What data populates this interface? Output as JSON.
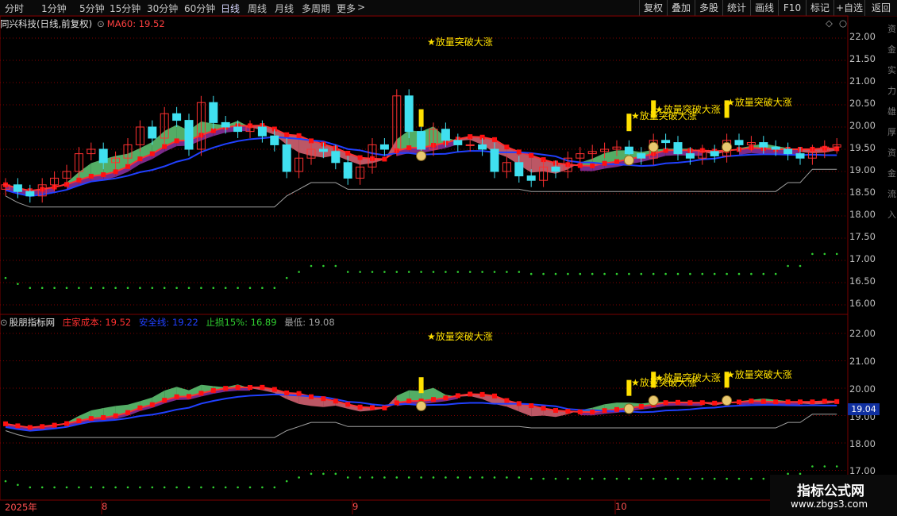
{
  "toolbar": {
    "periods": [
      "分时",
      "1分钟",
      "5分钟",
      "15分钟",
      "30分钟",
      "60分钟",
      "日线",
      "周线",
      "月线",
      "多周期",
      "更多"
    ],
    "active_period": "日线",
    "more_arrow": ">",
    "right_buttons": [
      "复权",
      "叠加",
      "多股",
      "统计",
      "画线",
      "F10",
      "标记",
      "+自选",
      "返回"
    ]
  },
  "main_panel": {
    "title": "同兴科技(日线,前复权)",
    "ma_label": "MA60: 19.52",
    "y_ticks": [
      "22.00",
      "21.50",
      "21.00",
      "20.50",
      "20.00",
      "19.50",
      "19.00",
      "18.50",
      "18.00",
      "17.50",
      "17.00",
      "16.50",
      "16.00"
    ],
    "signal_label": "★放量突破大涨"
  },
  "indicator_panel": {
    "title": "股朋指标网",
    "fields": [
      {
        "label": "庄家成本:",
        "value": "19.52",
        "color": "#ff3030"
      },
      {
        "label": "安全线:",
        "value": "19.22",
        "color": "#2040ff"
      },
      {
        "label": "止损15%:",
        "value": "16.89",
        "color": "#30d030"
      },
      {
        "label": "最低:",
        "value": "19.08",
        "color": "#a0a0a0"
      }
    ],
    "y_ticks": [
      "22.00",
      "21.00",
      "20.00",
      "19.00",
      "18.00",
      "17.00"
    ],
    "price_badge": "19.04",
    "signal_label": "★放量突破大涨"
  },
  "x_axis": {
    "labels": [
      "2025年",
      "8",
      "9",
      "10"
    ]
  },
  "side_text": "资金实力雄厚资金流入",
  "watermark": {
    "line1": "指标公式网",
    "line2": "www.zbgs3.com"
  },
  "colors": {
    "up": "#ff3030",
    "down": "#40e0f0",
    "ma_blue": "#2040ff",
    "green_band": "#5cc070",
    "purple_band": "#7a2a8a",
    "pink_band": "#d06070",
    "signal": "#ffe000",
    "grid": "#800000"
  },
  "chart_data": [
    {
      "type": "candlestick",
      "title": "同兴科技(日线,前复权)",
      "ylim": [
        16.0,
        22.0
      ],
      "x_labels": [
        "2025年",
        "8",
        "9",
        "10"
      ],
      "series": [
        {
          "name": "MA60",
          "last": 19.52
        },
        {
          "name": "close",
          "values": [
            18.7,
            18.55,
            18.45,
            18.7,
            18.85,
            19.0,
            19.4,
            19.5,
            19.2,
            19.3,
            19.6,
            20.0,
            19.75,
            20.3,
            20.15,
            19.5,
            20.55,
            20.1,
            20.0,
            19.9,
            20.0,
            19.8,
            19.6,
            19.0,
            19.3,
            19.5,
            19.45,
            19.2,
            18.85,
            19.1,
            19.6,
            19.5,
            20.7,
            19.9,
            19.5,
            19.95,
            19.7,
            19.6,
            19.6,
            19.5,
            19.0,
            19.2,
            18.9,
            18.8,
            19.1,
            19.0,
            19.3,
            19.4,
            19.45,
            19.5,
            19.55,
            19.4,
            19.3,
            19.7,
            19.65,
            19.4,
            19.3,
            19.45,
            19.35,
            19.7,
            19.6,
            19.65,
            19.55,
            19.5,
            19.4,
            19.3,
            19.45,
            19.55,
            19.6
          ]
        }
      ],
      "annotations": [
        "★放量突破大涨"
      ]
    },
    {
      "type": "line",
      "title": "股朋指标网",
      "ylim": [
        17.0,
        22.0
      ],
      "series": [
        {
          "name": "庄家成本",
          "last": 19.52
        },
        {
          "name": "安全线",
          "last": 19.22
        },
        {
          "name": "止损15%",
          "last": 16.89
        },
        {
          "name": "最低",
          "last": 19.08
        }
      ],
      "annotations": [
        "★放量突破大涨"
      ]
    }
  ]
}
